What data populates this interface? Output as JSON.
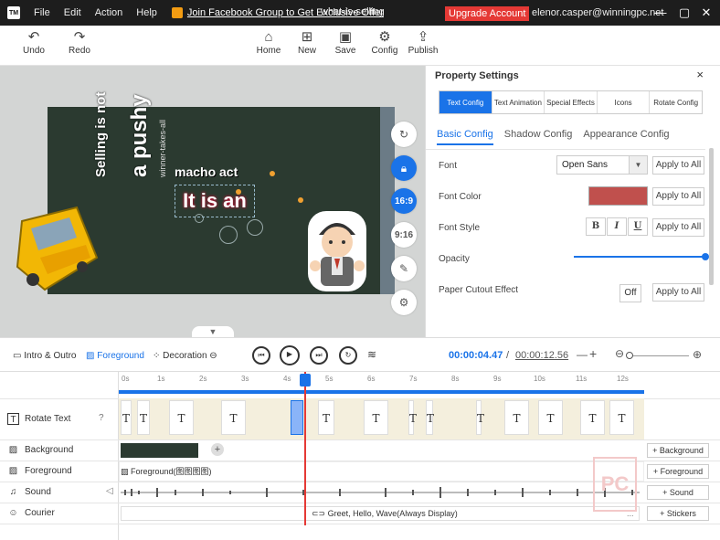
{
  "titlebar": {
    "app_icon": "TM",
    "menus": [
      "File",
      "Edit",
      "Action",
      "Help"
    ],
    "promo": "Join Facebook Group to Get Exclusive Offer",
    "filename": "what-is-selling",
    "upgrade": "Upgrade Account",
    "email": "elenor.casper@winningpc.net",
    "minimize": "—",
    "maximize": "▢",
    "close": "✕"
  },
  "toolbar": {
    "undo": "Undo",
    "redo": "Redo",
    "home": "Home",
    "new": "New",
    "save": "Save",
    "config": "Config",
    "publish": "Publish"
  },
  "canvas": {
    "text1": "Selling is not",
    "text2": "a pushy",
    "text3": "winner-takes-all",
    "text4": "macho act",
    "text5": "It is an",
    "ratio1": "16:9",
    "ratio2": "9:16"
  },
  "properties": {
    "title": "Property Settings",
    "close": "×",
    "tabs": [
      "Text Config",
      "Text Animation",
      "Special Effects",
      "Icons",
      "Rotate Config"
    ],
    "subtabs": [
      "Basic Config",
      "Shadow Config",
      "Appearance Config"
    ],
    "font_label": "Font",
    "font_value": "Open Sans",
    "font_color_label": "Font Color",
    "font_color": "#c0504d",
    "font_style_label": "Font Style",
    "bold": "B",
    "italic": "I",
    "underline": "U",
    "opacity_label": "Opacity",
    "opacity": 1.0,
    "cutout_label": "Paper Cutout Effect",
    "cutout_value": "Off",
    "apply": "Apply to All"
  },
  "timeline": {
    "intro": "Intro & Outro",
    "foreground": "Foreground",
    "decoration": "Decoration",
    "current_time": "00:00:04.47",
    "separator": "/",
    "total_time": "00:00:12.56",
    "ticks": [
      "0s",
      "1s",
      "2s",
      "3s",
      "4s",
      "5s",
      "6s",
      "7s",
      "8s",
      "9s",
      "10s",
      "11s",
      "12s"
    ],
    "tracks": {
      "rotate": "Rotate Text",
      "background": "Background",
      "foreground": "Foreground",
      "sound": "Sound",
      "courier": "Courier"
    },
    "foreground_clip": "Foreground(图图图图)",
    "courier_clip": "Greet, Hello, Wave(Always Display)",
    "courier_dots": "...",
    "add_background": "+ Background",
    "add_foreground": "+ Foreground",
    "add_sound": "+ Sound",
    "add_stickers": "+ Stickers"
  },
  "watermark": "PC"
}
